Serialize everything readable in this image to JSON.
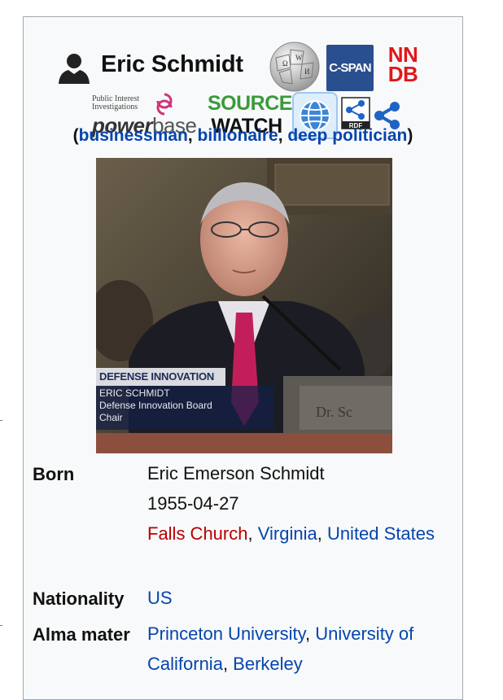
{
  "infobox": {
    "title": "Eric Schmidt",
    "icons": {
      "cspan": "C-SPAN",
      "nndb_line1": "NN",
      "nndb_line2": "DB",
      "powerbase_small_1": "Public Interest",
      "powerbase_small_2": "Investigations",
      "powerbase_word_1": "power",
      "powerbase_word_2": "base",
      "sourcewatch_1": "SOURCE",
      "sourcewatch_2": "WATCH",
      "rdf": "RDF",
      "wiki_glyphs": [
        "W",
        "Ω",
        "И"
      ]
    },
    "roles": {
      "open": "(",
      "items": [
        "businessman",
        "billionaire",
        "deep politician"
      ],
      "sep": ", ",
      "close": ")"
    },
    "portrait": {
      "banner": "DEFENSE INNOVATION",
      "name": "ERIC SCHMIDT",
      "line1": "Defense Innovation Board",
      "line2": "Chair",
      "nameplate": "Dr. Sc"
    },
    "rows": {
      "born": {
        "label": "Born",
        "name": "Eric Emerson Schmidt",
        "date": "1955-04-27",
        "place_city": "Falls Church",
        "place_state": "Virginia",
        "place_country": "United States",
        "sep": ", "
      },
      "nationality": {
        "label": "Nationality",
        "value": "US"
      },
      "alma_mater": {
        "label": "Alma mater",
        "school1": "Princeton University",
        "school2": "University of California",
        "school3": "Berkeley",
        "sep": ", "
      }
    }
  },
  "colors": {
    "link": "#0645ad",
    "redlink": "#ba0000",
    "box_bg": "#f8f9fa",
    "box_border": "#a2a9b1",
    "cspan_bg": "#2a4f8e",
    "nndb_red": "#e01818",
    "sourcewatch_green": "#3a9a3a"
  }
}
